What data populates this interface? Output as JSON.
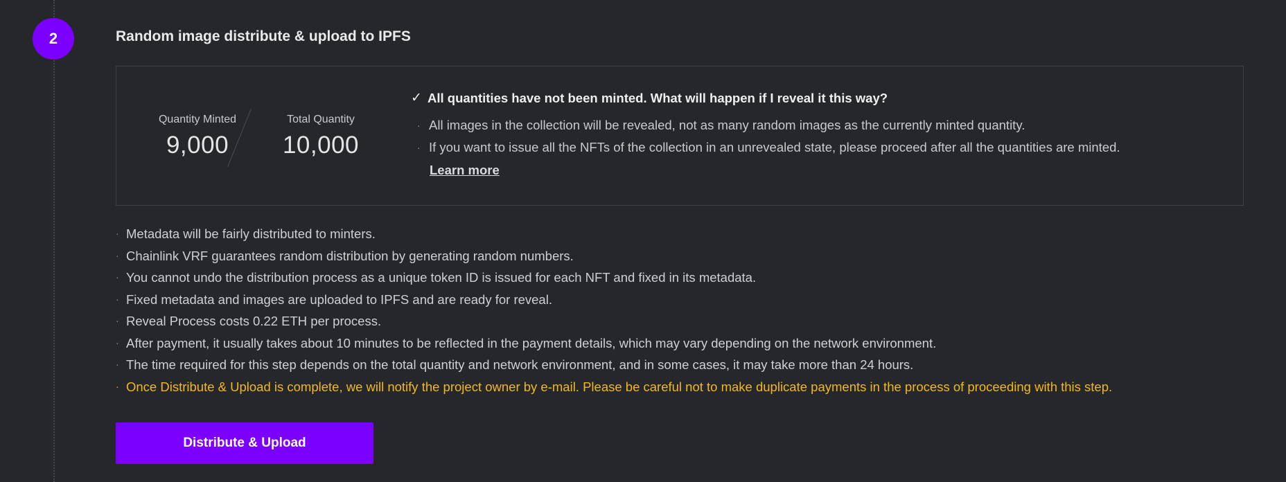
{
  "step": {
    "number": "2",
    "title": "Random image distribute & upload to IPFS"
  },
  "stats": {
    "minted_label": "Quantity Minted",
    "minted_value": "9,000",
    "total_label": "Total Quantity",
    "total_value": "10,000"
  },
  "notice": {
    "icon": "checkmark-icon",
    "title": "All quantities have not been minted. What will happen if I reveal it this way?",
    "items": [
      "All images in the collection will be revealed, not as many random images as the currently minted quantity.",
      "If you want to issue all the NFTs of the collection in an unrevealed state, please proceed after all the quantities are minted."
    ],
    "learn_more": "Learn more"
  },
  "bullets": [
    "Metadata will be fairly distributed to minters.",
    "Chainlink VRF guarantees random distribution by generating random numbers.",
    "You cannot undo the distribution process as a unique token ID is issued for each NFT and fixed in its metadata.",
    "Fixed metadata and images are uploaded to IPFS and are ready for reveal.",
    "Reveal Process costs 0.22 ETH per process.",
    "After payment, it usually takes about 10 minutes to be reflected in the payment details, which may vary depending on the network environment.",
    "The time required for this step depends on the total quantity and network environment, and in some cases, it may take more than 24 hours.",
    "Once Distribute & Upload is complete, we will notify the project owner by e-mail. Please be careful not to make duplicate payments in the process of proceeding with this step."
  ],
  "action": {
    "label": "Distribute & Upload"
  },
  "colors": {
    "background": "#25272b",
    "accent": "#7c00ff",
    "warning": "#f2b81d"
  }
}
